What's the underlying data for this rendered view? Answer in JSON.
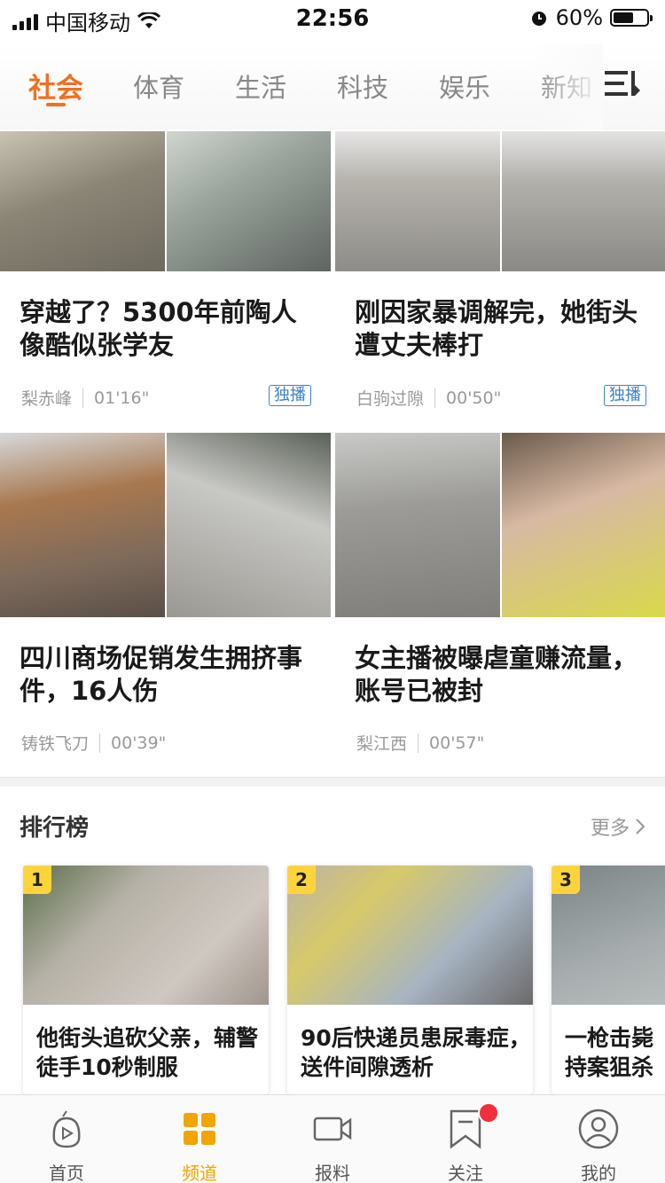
{
  "status_bar": {
    "carrier": "中国移动",
    "time": "22:56",
    "battery_percent": "60%",
    "battery_level": 0.6
  },
  "tabs": [
    "社会",
    "体育",
    "生活",
    "科技",
    "娱乐",
    "新知"
  ],
  "active_tab": 0,
  "videos": [
    {
      "title": "穿越了？5300年前陶人像酷似张学友",
      "author": "梨赤峰",
      "duration": "01'16\"",
      "badge": "独播"
    },
    {
      "title": "刚因家暴调解完，她街头遭丈夫棒打",
      "author": "白驹过隙",
      "duration": "00'50\"",
      "badge": "独播"
    },
    {
      "title": "四川商场促销发生拥挤事件，16人伤",
      "author": "铸铁飞刀",
      "duration": "00'39\"",
      "badge": ""
    },
    {
      "title": "女主播被曝虐童赚流量，账号已被封",
      "author": "梨江西",
      "duration": "00'57\"",
      "badge": ""
    }
  ],
  "ranking": {
    "title": "排行榜",
    "more": "更多",
    "items": [
      {
        "rank": "1",
        "title": "他街头追砍父亲，辅警徒手10秒制服"
      },
      {
        "rank": "2",
        "title": "90后快递员患尿毒症，送件间隙透析"
      },
      {
        "rank": "3",
        "title": "一枪击毙持案狙杀"
      }
    ]
  },
  "bottom_nav": [
    {
      "label": "首页",
      "icon": "play-bag-icon"
    },
    {
      "label": "频道",
      "icon": "grid-icon"
    },
    {
      "label": "报料",
      "icon": "video-camera-icon"
    },
    {
      "label": "关注",
      "icon": "bookmark-icon"
    },
    {
      "label": "我的",
      "icon": "profile-icon"
    }
  ],
  "colors": {
    "accent": "#f0701e",
    "badge": "#3c82c8",
    "nav_active": "#f0a500",
    "notification": "#f0303c"
  }
}
